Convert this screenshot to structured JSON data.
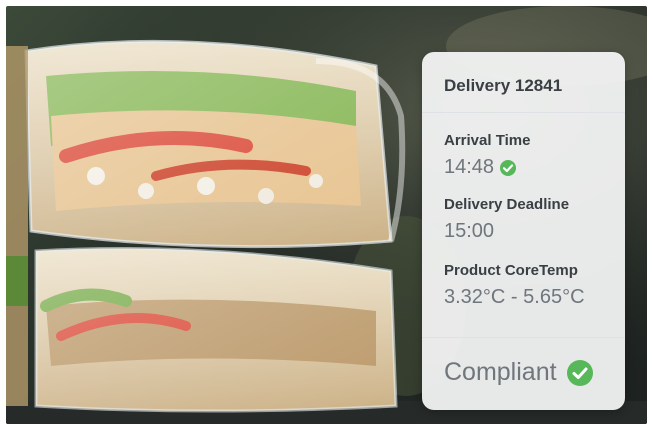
{
  "card": {
    "title": "Delivery 12841",
    "arrival": {
      "label": "Arrival Time",
      "value": "14:48"
    },
    "deadline": {
      "label": "Delivery Deadline",
      "value": "15:00"
    },
    "temp": {
      "label": "Product CoreTemp",
      "value": "3.32°C - 5.65°C"
    },
    "status": {
      "label": "Compliant"
    }
  },
  "colors": {
    "check": "#57b85a",
    "card_bg": "#f6f7f8",
    "label_text": "#3a3f44",
    "value_text": "#6f767c"
  },
  "icons": {
    "arrival_status": "check-circle-icon",
    "compliance_status": "check-circle-icon"
  }
}
